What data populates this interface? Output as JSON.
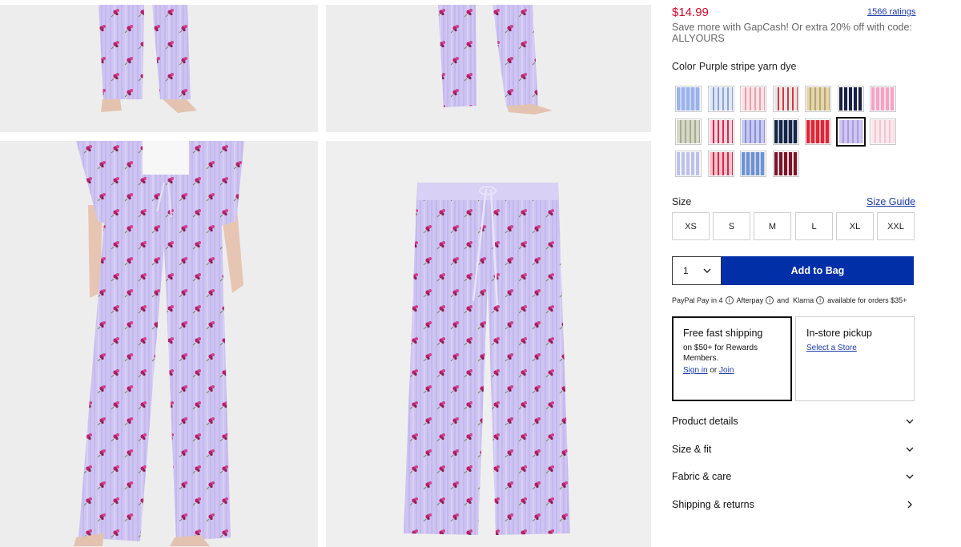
{
  "product": {
    "price": "$14.99",
    "ratings": "1566 ratings",
    "promo": "Save more with GapCash! Or extra 20% off with code: ALLYOURS",
    "color_label": "Color",
    "color_value": "Purple stripe yarn dye"
  },
  "swatches": [
    {
      "name": "blue-stripe",
      "colors": [
        "#9bb3ea",
        "#c8d6f5"
      ]
    },
    {
      "name": "blue-floral",
      "colors": [
        "#dfe6f6",
        "#8ea3cf"
      ]
    },
    {
      "name": "pink-hearts",
      "colors": [
        "#fbe2e6",
        "#e8a0aa"
      ]
    },
    {
      "name": "grey-heart",
      "colors": [
        "#e6e6ea",
        "#d23a3a"
      ]
    },
    {
      "name": "tan-stripe",
      "colors": [
        "#e5d6a8",
        "#b5a579"
      ]
    },
    {
      "name": "navy-dots",
      "colors": [
        "#1a2146",
        "#f2f2f2"
      ]
    },
    {
      "name": "pink-stripe",
      "colors": [
        "#f5a3c2",
        "#fbe2ec"
      ]
    },
    {
      "name": "green-plaid",
      "colors": [
        "#d6d9c6",
        "#a7ab93"
      ]
    },
    {
      "name": "pink-cherry",
      "colors": [
        "#f7d2de",
        "#d52b4b"
      ]
    },
    {
      "name": "purple-plaid",
      "colors": [
        "#c7c9f0",
        "#8d8fd6"
      ]
    },
    {
      "name": "navy-floral",
      "colors": [
        "#172642",
        "#a9b7cf"
      ]
    },
    {
      "name": "red-plaid",
      "colors": [
        "#dd2738",
        "#f4a4ac"
      ]
    },
    {
      "name": "purple-stripe-yarn-dye",
      "colors": [
        "#cfc7f0",
        "#a79be0"
      ],
      "selected": true
    },
    {
      "name": "pale-pink",
      "colors": [
        "#fbe8ee",
        "#f0c7d3"
      ]
    },
    {
      "name": "lilac-stripe",
      "colors": [
        "#bdc1e8",
        "#f2f2fb"
      ]
    },
    {
      "name": "pink-roses",
      "colors": [
        "#f5c2cb",
        "#d2294a"
      ]
    },
    {
      "name": "blue-rainbow",
      "colors": [
        "#5e98dc",
        "#e8c6d4"
      ]
    },
    {
      "name": "maroon-bows",
      "colors": [
        "#7a1628",
        "#f3d6dc"
      ]
    }
  ],
  "size": {
    "label": "Size",
    "guide": "Size Guide",
    "options": [
      "XS",
      "S",
      "M",
      "L",
      "XL",
      "XXL"
    ]
  },
  "cart": {
    "quantity": "1",
    "add_label": "Add to Bag"
  },
  "paylater": {
    "paypal": "PayPal Pay in 4",
    "afterpay": "Afterpay",
    "and": "and",
    "klarna": "Klarna",
    "tail": "available for orders $35+"
  },
  "shipping": {
    "title": "Free fast shipping",
    "text": "on $50+ for Rewards Members.",
    "signin": "Sign in",
    "or": "or",
    "join": "Join"
  },
  "pickup": {
    "title": "In-store pickup",
    "link": "Select a Store"
  },
  "accordions": [
    {
      "label": "Product details",
      "icon": "chevron-down-icon"
    },
    {
      "label": "Size & fit",
      "icon": "chevron-down-icon"
    },
    {
      "label": "Fabric & care",
      "icon": "chevron-down-icon"
    },
    {
      "label": "Shipping & returns",
      "icon": "chevron-right-icon"
    }
  ],
  "colors": {
    "price": "#d00a2c",
    "link": "#1b3aa6",
    "primary_button": "#002fa8",
    "fabric": "#c9c1ee",
    "flower": "#b2226a"
  }
}
